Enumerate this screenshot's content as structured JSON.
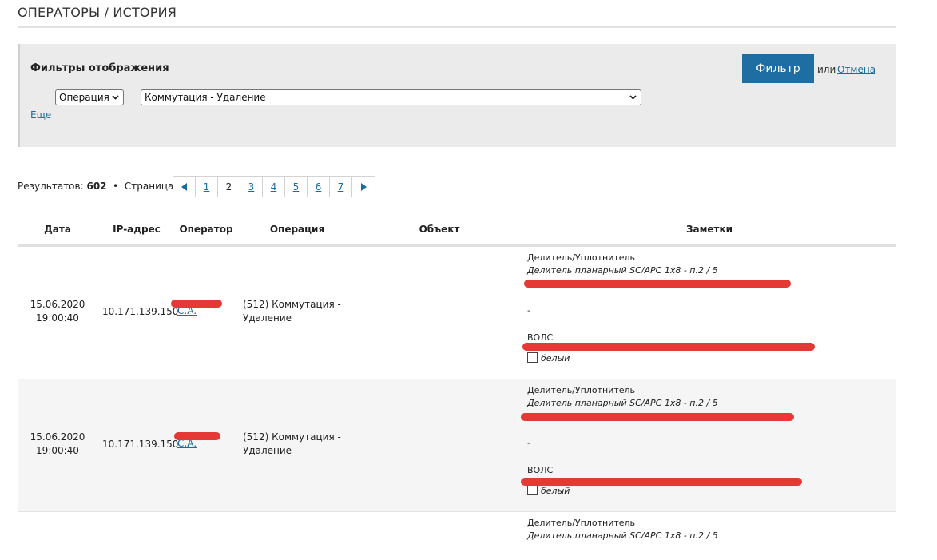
{
  "header": {
    "title": "ОПЕРАТОРЫ / ИСТОРИЯ"
  },
  "filters": {
    "heading": "Фильтры отображения",
    "field_select": "Операция",
    "value_select": "Коммутация - Удаление",
    "more_link": "Еще",
    "filter_button": "Фильтр",
    "or_text": "или",
    "cancel_link": "Отмена"
  },
  "results": {
    "label": "Результатов:",
    "count": "602",
    "separator": "•",
    "page_label": "Страница",
    "pages": [
      "1",
      "2",
      "3",
      "4",
      "5",
      "6",
      "7"
    ],
    "current_page": "2"
  },
  "table": {
    "columns": [
      "Дата",
      "IP-адрес",
      "Оператор",
      "Операция",
      "Объект",
      "Заметки"
    ],
    "rows": [
      {
        "date": "15.06.2020",
        "time": "19:00:40",
        "ip": "10.171.139.150",
        "operator_suffix": "С.А.",
        "operation_line1": "(512) Коммутация -",
        "operation_line2": "Удаление",
        "notes": {
          "device_type": "Делитель/Уплотнитель",
          "device_name": "Делитель планарный SC/APC 1x8 - п.2 / 5",
          "dash": "-",
          "cable_type": "ВОЛС",
          "fiber_color": "белый"
        }
      },
      {
        "date": "15.06.2020",
        "time": "19:00:40",
        "ip": "10.171.139.150",
        "operator_suffix": "С.А.",
        "operation_line1": "(512) Коммутация -",
        "operation_line2": "Удаление",
        "notes": {
          "device_type": "Делитель/Уплотнитель",
          "device_name": "Делитель планарный SC/APC 1x8 - п.2 / 5",
          "dash": "-",
          "cable_type": "ВОЛС",
          "fiber_color": "белый"
        }
      },
      {
        "notes": {
          "device_type": "Делитель/Уплотнитель",
          "device_name": "Делитель планарный SC/APC 1x8 - п.2 / 5"
        }
      }
    ]
  },
  "colors": {
    "accent": "#1e6ea3",
    "link": "#1a6da1",
    "redaction": "#e53935",
    "panel": "#ebebeb"
  }
}
